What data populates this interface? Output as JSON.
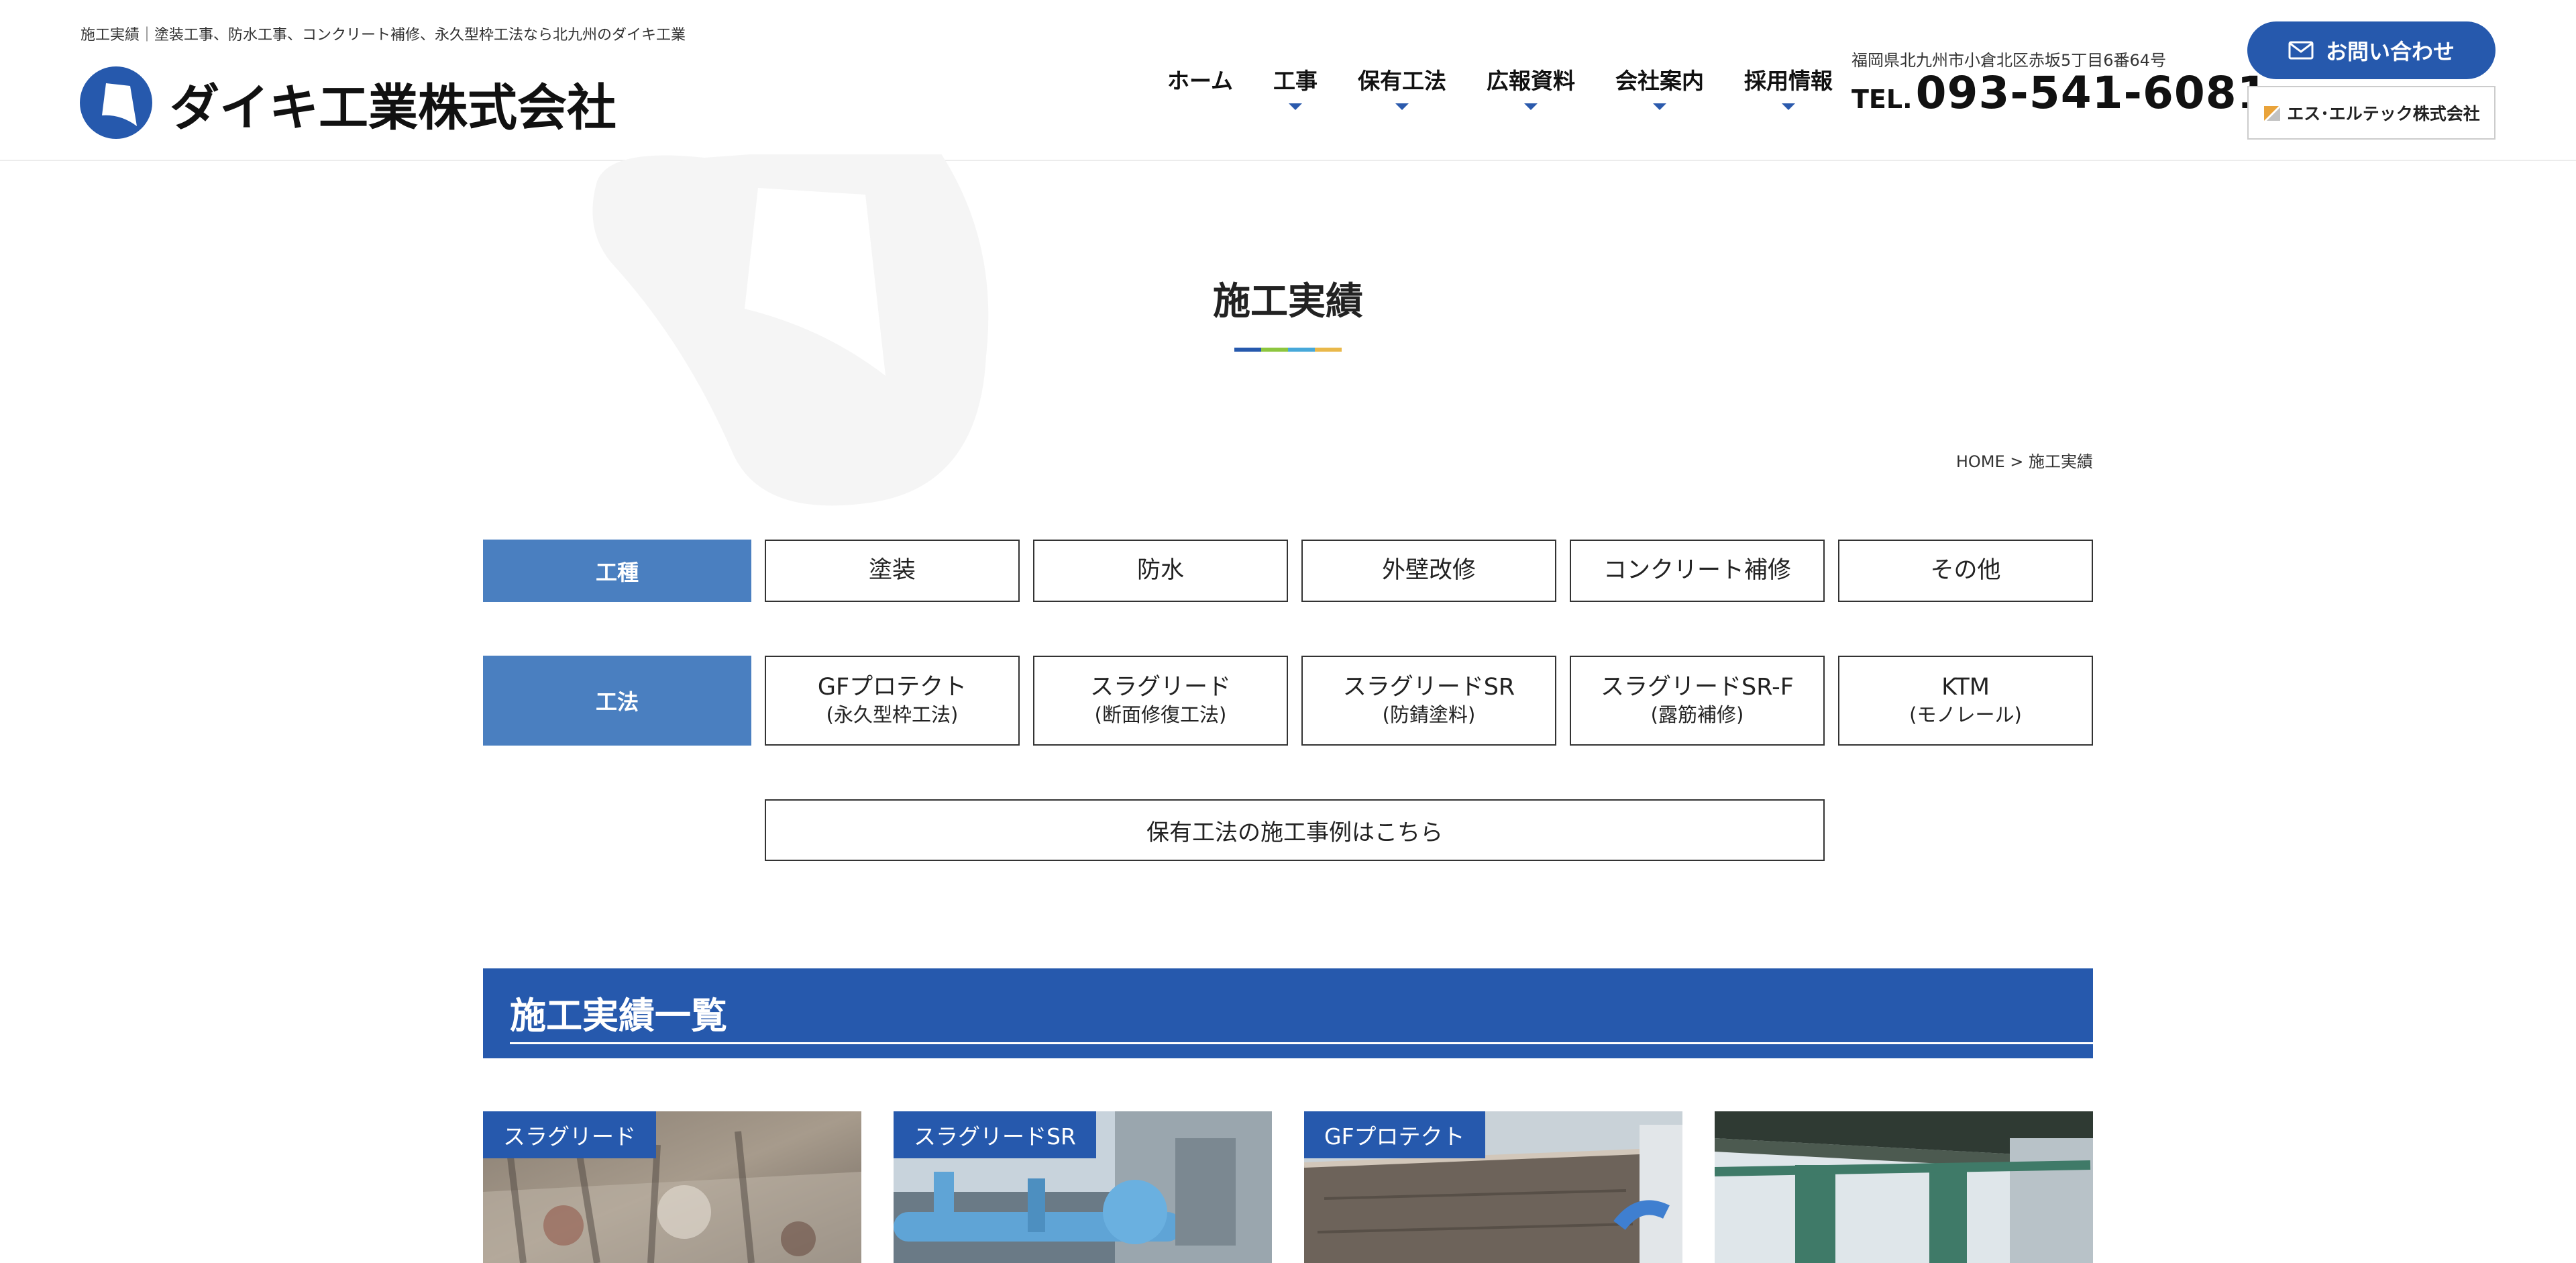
{
  "header": {
    "tagline": "施工実績｜塗装工事、防水工事、コンクリート補修、永久型枠工法なら北九州のダイキ工業",
    "logo_text": "ダイキ工業株式会社",
    "nav": [
      {
        "label": "ホーム",
        "has_dropdown": false
      },
      {
        "label": "工事",
        "has_dropdown": true
      },
      {
        "label": "保有工法",
        "has_dropdown": true
      },
      {
        "label": "広報資料",
        "has_dropdown": true
      },
      {
        "label": "会社案内",
        "has_dropdown": true
      },
      {
        "label": "採用情報",
        "has_dropdown": true
      }
    ],
    "address": "福岡県北九州市小倉北区赤坂5丁目6番64号",
    "tel_label": "TEL.",
    "tel_number": "093-541-6081",
    "contact_label": "お問い合わせ",
    "partner_label": "エス･エルテック株式会社"
  },
  "page": {
    "title": "施工実績",
    "title_bar_colors": [
      "#2659ad",
      "#8dc63f",
      "#47a8d9",
      "#e9b84a"
    ],
    "breadcrumb": "HOME > 施工実績"
  },
  "filters": {
    "work_type": {
      "label": "工種",
      "options": [
        "塗装",
        "防水",
        "外壁改修",
        "コンクリート補修",
        "その他"
      ]
    },
    "method": {
      "label": "工法",
      "options": [
        {
          "name": "GFプロテクト",
          "sub": "(永久型枠工法)"
        },
        {
          "name": "スラグリード",
          "sub": "(断面修復工法)"
        },
        {
          "name": "スラグリードSR",
          "sub": "(防錆塗料)"
        },
        {
          "name": "スラグリードSR-F",
          "sub": "(露筋補修)"
        },
        {
          "name": "KTM",
          "sub": "(モノレール)"
        }
      ]
    },
    "method_cases_link": "保有工法の施工事例はこちら"
  },
  "list": {
    "title": "施工実績一覧",
    "cards": [
      {
        "tag": "スラグリード"
      },
      {
        "tag": "スラグリードSR"
      },
      {
        "tag": "GFプロテクト"
      },
      {
        "tag": ""
      }
    ]
  },
  "colors": {
    "brand_blue": "#2659ad",
    "label_blue": "#4a7fc0"
  }
}
